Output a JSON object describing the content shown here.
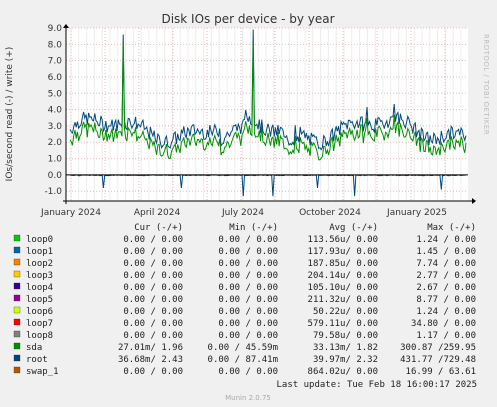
{
  "title": "Disk IOs per device - by year",
  "side_text": "RRDTOOL / TOBI OETIKER",
  "footer": "Munin 2.0.75",
  "last_update": "Last update: Tue Feb 18 16:00:17 2025",
  "colors": {
    "background": "#f0f0f0",
    "plot": "#ffffff",
    "grid_major": "#e8b8b8",
    "grid_minor": "#ececec",
    "axis": "#000000",
    "series_sda": "#00aa00",
    "series_root": "#0b5394"
  },
  "legend_header": {
    "cur": "Cur (-/+)",
    "min": "Min (-/+)",
    "avg": "Avg (-/+)",
    "max": "Max (-/+)"
  },
  "chart_data": {
    "type": "line",
    "title": "Disk IOs per device - by year",
    "ylabel": "IOs/second read (-) / write (+)",
    "ylim": [
      -1.6,
      9.0
    ],
    "yticks": [
      "9.0",
      "8.0",
      "7.0",
      "6.0",
      "5.0",
      "4.0",
      "3.0",
      "2.0",
      "1.0",
      "0.0",
      "-1.0"
    ],
    "yticks_values": [
      9,
      8,
      7,
      6,
      5,
      4,
      3,
      2,
      1,
      0,
      -1
    ],
    "xticks": [
      "January 2024",
      "April 2024",
      "July 2024",
      "October 2024",
      "January 2025"
    ],
    "grid": true,
    "series": [
      {
        "name": "loop0",
        "color": "#00cc00",
        "cur": "0.00 /  0.00",
        "min": "0.00 /  0.00",
        "avg": "113.56u/  0.00",
        "max": "1.24 /  0.00"
      },
      {
        "name": "loop1",
        "color": "#0066b3",
        "cur": "0.00 /  0.00",
        "min": "0.00 /  0.00",
        "avg": "117.93u/  0.00",
        "max": "1.45 /  0.00"
      },
      {
        "name": "loop2",
        "color": "#ff8000",
        "cur": "0.00 /  0.00",
        "min": "0.00 /  0.00",
        "avg": "187.85u/  0.00",
        "max": "7.74 /  0.00"
      },
      {
        "name": "loop3",
        "color": "#ffcc00",
        "cur": "0.00 /  0.00",
        "min": "0.00 /  0.00",
        "avg": "204.14u/  0.00",
        "max": "2.77 /  0.00"
      },
      {
        "name": "loop4",
        "color": "#330099",
        "cur": "0.00 /  0.00",
        "min": "0.00 /  0.00",
        "avg": "105.10u/  0.00",
        "max": "2.67 /  0.00"
      },
      {
        "name": "loop5",
        "color": "#990099",
        "cur": "0.00 /  0.00",
        "min": "0.00 /  0.00",
        "avg": "211.32u/  0.00",
        "max": "8.77 /  0.00"
      },
      {
        "name": "loop6",
        "color": "#ccff00",
        "cur": "0.00 /  0.00",
        "min": "0.00 /  0.00",
        "avg": "50.22u/  0.00",
        "max": "1.24 /  0.00"
      },
      {
        "name": "loop7",
        "color": "#ff0000",
        "cur": "0.00 /  0.00",
        "min": "0.00 /  0.00",
        "avg": "579.11u/  0.00",
        "max": "34.80 /  0.00"
      },
      {
        "name": "loop8",
        "color": "#808080",
        "cur": "0.00 /  0.00",
        "min": "0.00 /  0.00",
        "avg": "79.58u/  0.00",
        "max": "1.17 /  0.00"
      },
      {
        "name": "sda",
        "color": "#008f00",
        "cur": "27.01m/  1.96",
        "min": "0.00 / 45.59m",
        "avg": "33.13m/  1.82",
        "max": "300.87 /259.95"
      },
      {
        "name": "root",
        "color": "#00487d",
        "cur": "36.68m/  2.43",
        "min": "0.00 / 87.41m",
        "avg": "39.97m/  2.32",
        "max": "431.77 /729.48"
      },
      {
        "name": "swap_1",
        "color": "#b35a00",
        "cur": "0.00 /  0.00",
        "min": "0.00 /  0.00",
        "avg": "864.02u/  0.00",
        "max": "16.99 / 63.61"
      }
    ]
  }
}
